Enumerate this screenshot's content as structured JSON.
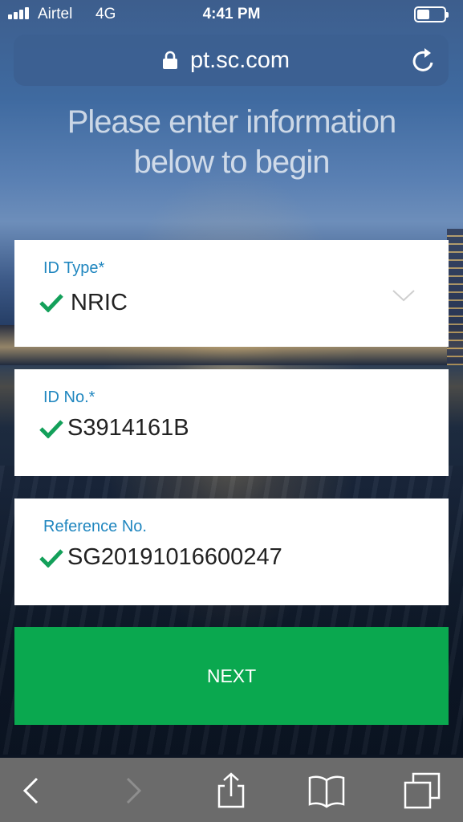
{
  "status_bar": {
    "carrier": "Airtel",
    "network": "4G",
    "time": "4:41 PM",
    "battery_level": 0.45
  },
  "browser": {
    "url": "pt.sc.com",
    "icons": [
      "lock-icon",
      "reload-icon"
    ]
  },
  "page": {
    "headline_line1": "Please enter information",
    "headline_line2": "below to begin"
  },
  "form": {
    "id_type": {
      "label": "ID Type*",
      "value": "NRIC",
      "valid": true
    },
    "id_no": {
      "label": "ID No.*",
      "value": "S3914161B",
      "valid": true
    },
    "reference_no": {
      "label": "Reference No.",
      "value": "SG20191016600247",
      "valid": true
    },
    "next_label": "NEXT"
  },
  "toolbar": {
    "icons": [
      "back-icon",
      "forward-icon",
      "share-icon",
      "bookmarks-icon",
      "tabs-icon"
    ]
  },
  "colors": {
    "accent_green": "#0aa84f",
    "label_blue": "#1f86bf",
    "check_green": "#13a05a"
  }
}
